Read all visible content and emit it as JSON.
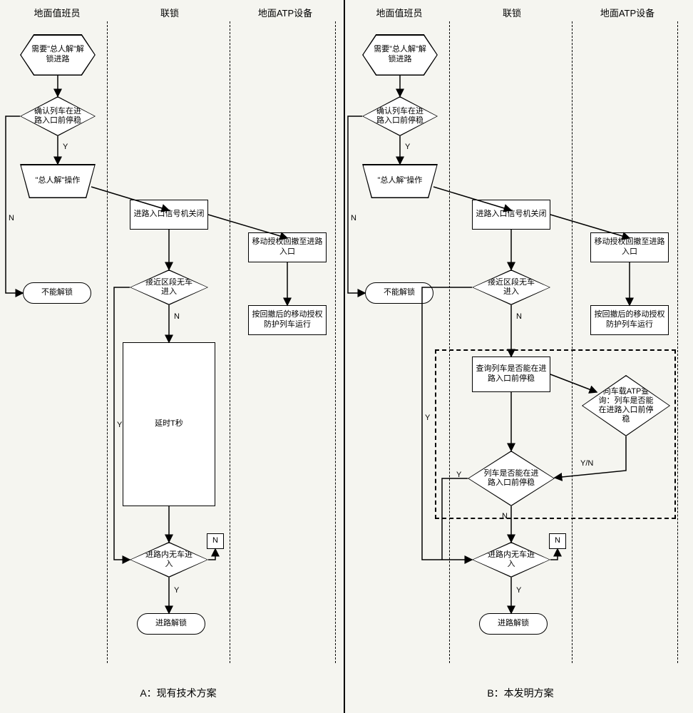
{
  "lanes": {
    "a1": "地面值班员",
    "a2": "联锁",
    "a3": "地面ATP设备",
    "b1": "地面值班员",
    "b2": "联锁",
    "b3": "地面ATP设备"
  },
  "nodes": {
    "start": "需要\"总人解\"解锁进路",
    "confirm_stopped": "确认列车在进路入口前停稳",
    "op_total_release": "\"总人解\"操作",
    "cannot_unlock": "不能解锁",
    "signal_close": "进路入口信号机关闭",
    "approach_clear": "接近区段无车进入",
    "delay_t": "延时T秒",
    "route_clear": "进路内无车进入",
    "route_unlock": "进路解锁",
    "ma_retract": "移动授权回撤至进路入口",
    "ma_protect": "按回撤后的移动授权防护列车运行",
    "query_can_stop": "查询列车是否能在进路入口前停稳",
    "ask_onboard_atp": "向车载ATP查询：列车是否能在进路入口前停稳",
    "can_stop_decision": "列车是否能在进路入口前停稳"
  },
  "labels": {
    "Y": "Y",
    "N": "N",
    "YN": "Y/N"
  },
  "captions": {
    "a": "A：现有技术方案",
    "b": "B：本发明方案"
  }
}
